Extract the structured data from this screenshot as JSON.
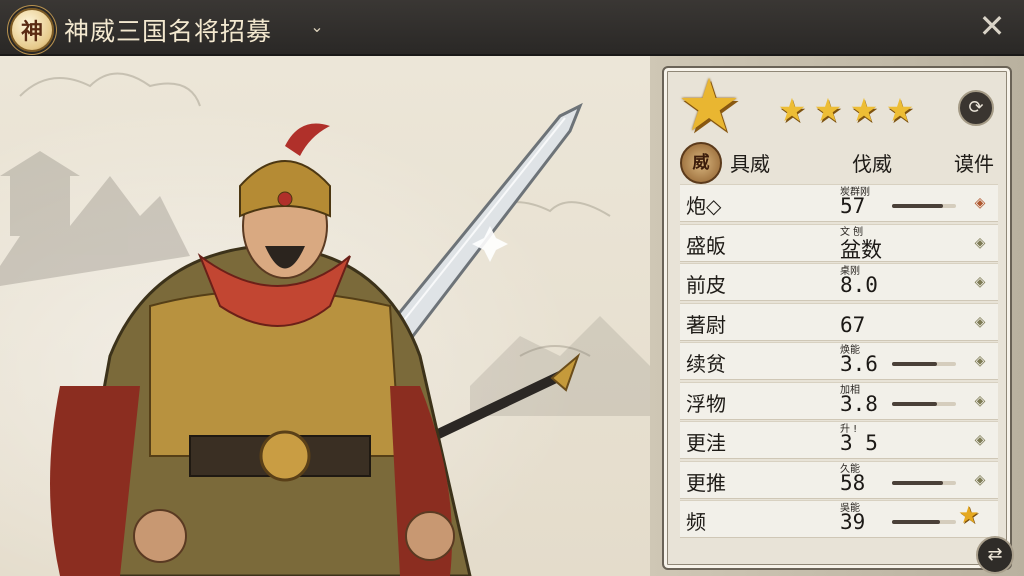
{
  "header": {
    "emblem_char": "神",
    "title": "神威三国名将招募",
    "dropdown_caret": "⌄",
    "close_glyph": "✕"
  },
  "panel": {
    "big_star": "★",
    "rating_stars": 4,
    "settings_glyph": "⟳",
    "header_badge": "威",
    "columns": [
      "具威",
      "伐威",
      "谟件"
    ],
    "stats": [
      {
        "name": "炮◇",
        "sub": "炭群刚",
        "value": "57",
        "bar": 0.8,
        "icon": "red-diamond-icon"
      },
      {
        "name": "盛皈",
        "sub": "文 刨",
        "value": "盆数",
        "bar": null,
        "icon": "green-diamond-icon"
      },
      {
        "name": "前皮",
        "sub": "桌刚",
        "value": "8.0",
        "bar": null,
        "icon": "green-diamond-icon"
      },
      {
        "name": "著尉",
        "sub": "",
        "value": "67",
        "bar": null,
        "icon": "green-diamond-icon"
      },
      {
        "name": "续贫",
        "sub": "焕能",
        "value": "3.6",
        "bar": 0.7,
        "icon": "green-diamond-icon"
      },
      {
        "name": "浮物",
        "sub": "加相",
        "value": "3.8",
        "bar": 0.7,
        "icon": "green-diamond-icon"
      },
      {
        "name": "更洼",
        "sub": "升 !",
        "value": "3 5",
        "bar": null,
        "icon": "green-diamond-icon"
      },
      {
        "name": "更推",
        "sub": "久能",
        "value": "58",
        "bar": 0.8,
        "icon": "green-diamond-icon"
      },
      {
        "name": "频",
        "sub": "吳能",
        "value": "39",
        "bar": 0.75,
        "icon": "gold-star-icon"
      }
    ],
    "swap_glyph": "⇄"
  },
  "colors": {
    "topbar": "#2f2c29",
    "title_text": "#f3e8cf",
    "gold_star": "#e9b631",
    "panel_bg": "#e8e3d7"
  }
}
